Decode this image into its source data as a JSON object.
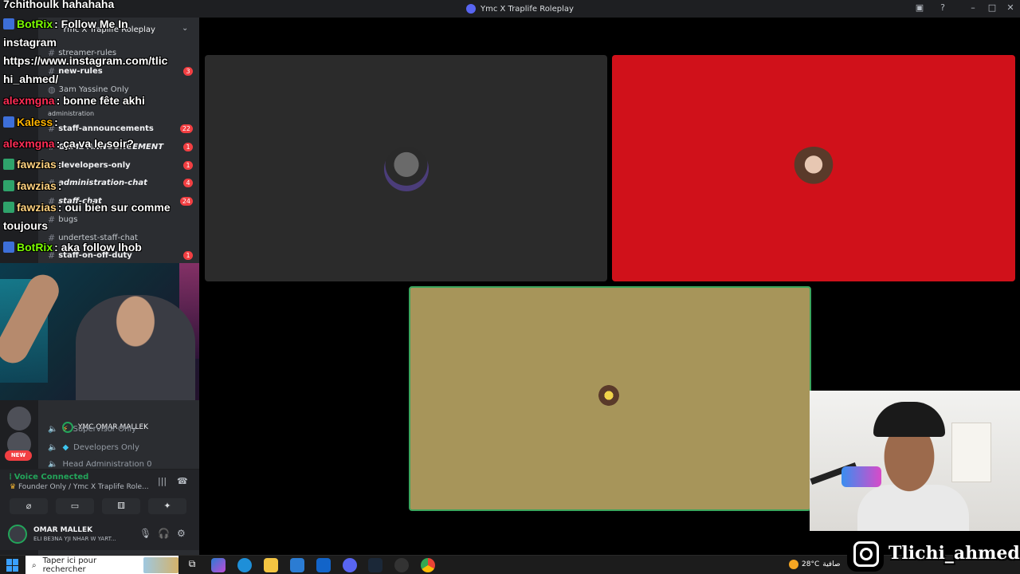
{
  "window": {
    "title": "Ymc X Traplife Roleplay"
  },
  "server": {
    "name": "Ymc X Traplife Roleplay"
  },
  "channels": [
    {
      "name": "streamer-rules",
      "badge": ""
    },
    {
      "name": "new-rules",
      "badge": "3"
    },
    {
      "name": "3am Yassine Only",
      "badge": ""
    },
    {
      "name": "administration",
      "badge": ""
    },
    {
      "name": "staff-announcements",
      "badge": "22"
    },
    {
      "name": "GAME ANNOUNCEMENT",
      "badge": "1"
    },
    {
      "name": "developers-only",
      "badge": "1"
    },
    {
      "name": "administration-chat",
      "badge": "4"
    },
    {
      "name": "staff-chat",
      "badge": "24"
    },
    {
      "name": "bugs",
      "badge": ""
    },
    {
      "name": "undertest-staff-chat",
      "badge": ""
    },
    {
      "name": "staff-on-off-duty",
      "badge": "1"
    }
  ],
  "chat": [
    {
      "user": "",
      "text": "7chithoulk hahahaha",
      "color": "#ffffff"
    },
    {
      "user": "BotRix",
      "text": ": Follow Me In",
      "color": "#7cfc00"
    },
    {
      "user": "",
      "text": "instagram",
      "color": "#ffffff"
    },
    {
      "user": "",
      "text": "https://www.instagram.com/tlic",
      "color": "#ffffff"
    },
    {
      "user": "",
      "text": "hi_ahmed/",
      "color": "#ffffff"
    },
    {
      "user": "alexmgna",
      "text": ": bonne fête akhi",
      "color": "#ff2d55"
    },
    {
      "user": "Kaless",
      "text": ":",
      "color": "#ffb400"
    },
    {
      "user": "alexmgna",
      "text": ": ça va le soir?",
      "color": "#ff2d55"
    },
    {
      "user": "fawzias",
      "text": ":",
      "color": "#ffd27f"
    },
    {
      "user": "fawzias",
      "text": ":",
      "color": "#ffd27f"
    },
    {
      "user": "fawzias",
      "text": ": oui bien sur comme",
      "color": "#ffd27f"
    },
    {
      "user": "",
      "text": "toujours",
      "color": "#ffffff"
    },
    {
      "user": "BotRix",
      "text": ": aka follow lhob",
      "color": "#7cfc00"
    }
  ],
  "voice": {
    "user_label": "YMC  OMAR MALLEK",
    "channels": [
      "Supervisor Only",
      "Developers Only",
      "Head Administration 0"
    ],
    "new_badge": "NEW"
  },
  "voice_panel": {
    "status": "Voice Connected",
    "location": "Founder Only / Ymc X Traplife Role..."
  },
  "user_panel": {
    "name": "OMAR MALLEK",
    "status": "ELI BE3NA YJI NHAR W YART..."
  },
  "overlay": {
    "instagram_handle": "Tlichi_ahmed"
  },
  "taskbar": {
    "search_placeholder": "Taper ici pour rechercher",
    "weather": "28°C",
    "weather_desc": "صافية"
  },
  "colors": {
    "accent": "#5865f2",
    "voice_green": "#23a55a",
    "badge_red": "#f23f42",
    "tile_red": "#d0111a",
    "tile_olive": "#a7955a"
  }
}
